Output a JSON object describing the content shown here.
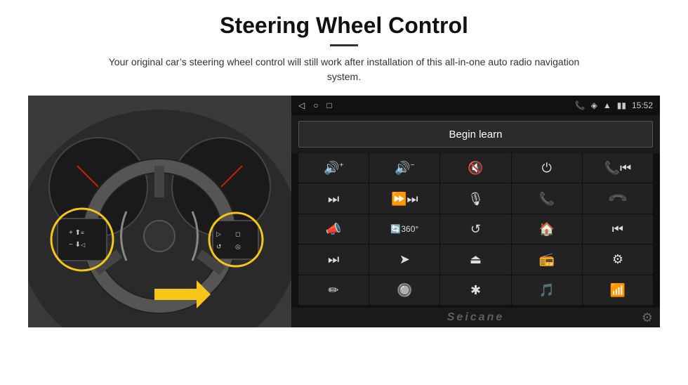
{
  "header": {
    "title": "Steering Wheel Control",
    "subtitle": "Your original car’s steering wheel control will still work after installation of this all-in-one auto radio navigation system."
  },
  "topbar": {
    "time": "15:52",
    "icons": [
      "◁",
      "○",
      "□"
    ]
  },
  "begin_learn": {
    "label": "Begin learn"
  },
  "grid": {
    "cells": [
      {
        "icon": "🔊+",
        "label": "volume-up"
      },
      {
        "icon": "🔊−",
        "label": "volume-down"
      },
      {
        "icon": "🔇",
        "label": "mute"
      },
      {
        "icon": "⏻",
        "label": "power"
      },
      {
        "icon": "⏮",
        "label": "prev-track-phone"
      },
      {
        "icon": "⏭",
        "label": "next"
      },
      {
        "icon": "⏩",
        "label": "fast-forward"
      },
      {
        "icon": "🎙",
        "label": "mic"
      },
      {
        "icon": "📞",
        "label": "phone"
      },
      {
        "icon": "↩",
        "label": "hang-up"
      },
      {
        "icon": "📣",
        "label": "horn"
      },
      {
        "icon": "🔄",
        "label": "360"
      },
      {
        "icon": "↺",
        "label": "back"
      },
      {
        "icon": "🏠",
        "label": "home"
      },
      {
        "icon": "⏮⏮",
        "label": "rewind"
      },
      {
        "icon": "⏭",
        "label": "skip"
      },
      {
        "icon": "➤",
        "label": "nav"
      },
      {
        "icon": "⏏",
        "label": "eject"
      },
      {
        "icon": "📻",
        "label": "radio"
      },
      {
        "icon": "⚙",
        "label": "settings-eq"
      },
      {
        "icon": "✏",
        "label": "edit"
      },
      {
        "icon": "🔘",
        "label": "knob"
      },
      {
        "icon": "✱",
        "label": "bluetooth"
      },
      {
        "icon": "🎵",
        "label": "music"
      },
      {
        "icon": "📶",
        "label": "equalizer"
      }
    ]
  },
  "watermark": {
    "text": "Seicane"
  }
}
